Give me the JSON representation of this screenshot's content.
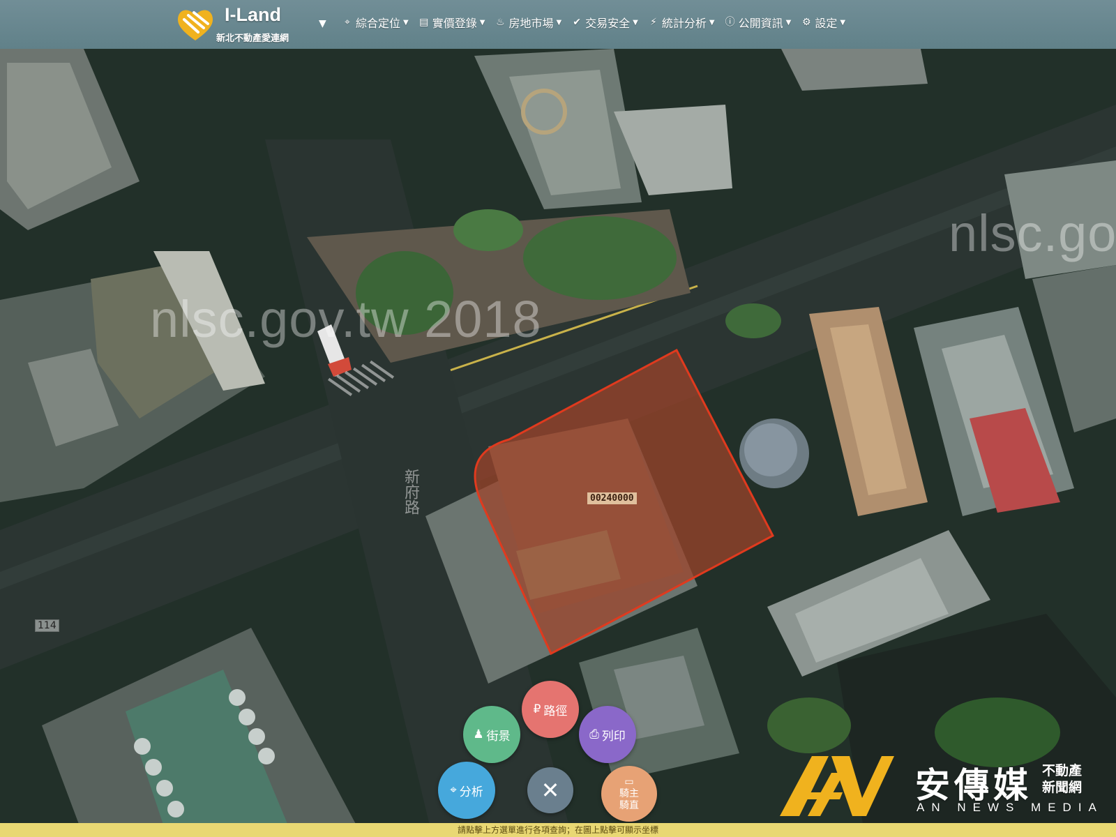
{
  "app": {
    "title": "I-Land",
    "subtitle": "新北不動產愛連網"
  },
  "nav": {
    "items": [
      {
        "icon": "map-pin-icon",
        "label": "綜合定位"
      },
      {
        "icon": "register-icon",
        "label": "實價登錄"
      },
      {
        "icon": "fire-icon",
        "label": "房地市場"
      },
      {
        "icon": "check-circle-icon",
        "label": "交易安全"
      },
      {
        "icon": "chart-line-icon",
        "label": "統計分析"
      },
      {
        "icon": "info-icon",
        "label": "公開資訊"
      },
      {
        "icon": "gear-icon",
        "label": "設定"
      }
    ]
  },
  "map": {
    "watermark_1": "nlsc.gov.tw 2018",
    "watermark_2": "nlsc.gov",
    "parcel_number": "00240000",
    "road_label": "新府路",
    "road_number": "114"
  },
  "radial_menu": {
    "route": "路徑",
    "street_view": "街景",
    "print": "列印",
    "analysis": "分析",
    "close": "✕",
    "owner_line1": "騎主",
    "owner_line2": "騎直"
  },
  "hint": "請點擊上方選單進行各項查詢；在圖上點擊可顯示坐標",
  "watermark_brand": {
    "name": "安傳媒",
    "tag_line1": "不動產",
    "tag_line2": "新聞網",
    "english": "AN NEWS MEDIA"
  },
  "colors": {
    "parcel_outline": "#e03a1e",
    "parcel_fill": "#a0442a",
    "topbar": "#6f959f",
    "hint_bar": "#e9d873",
    "fab_route": "#e57470",
    "fab_street": "#5fb98a",
    "fab_print": "#8a68c9",
    "fab_analysis": "#46a8dc",
    "fab_close": "#6a7f8e",
    "fab_owner": "#e7a275",
    "brand_gold": "#f0b21e"
  }
}
